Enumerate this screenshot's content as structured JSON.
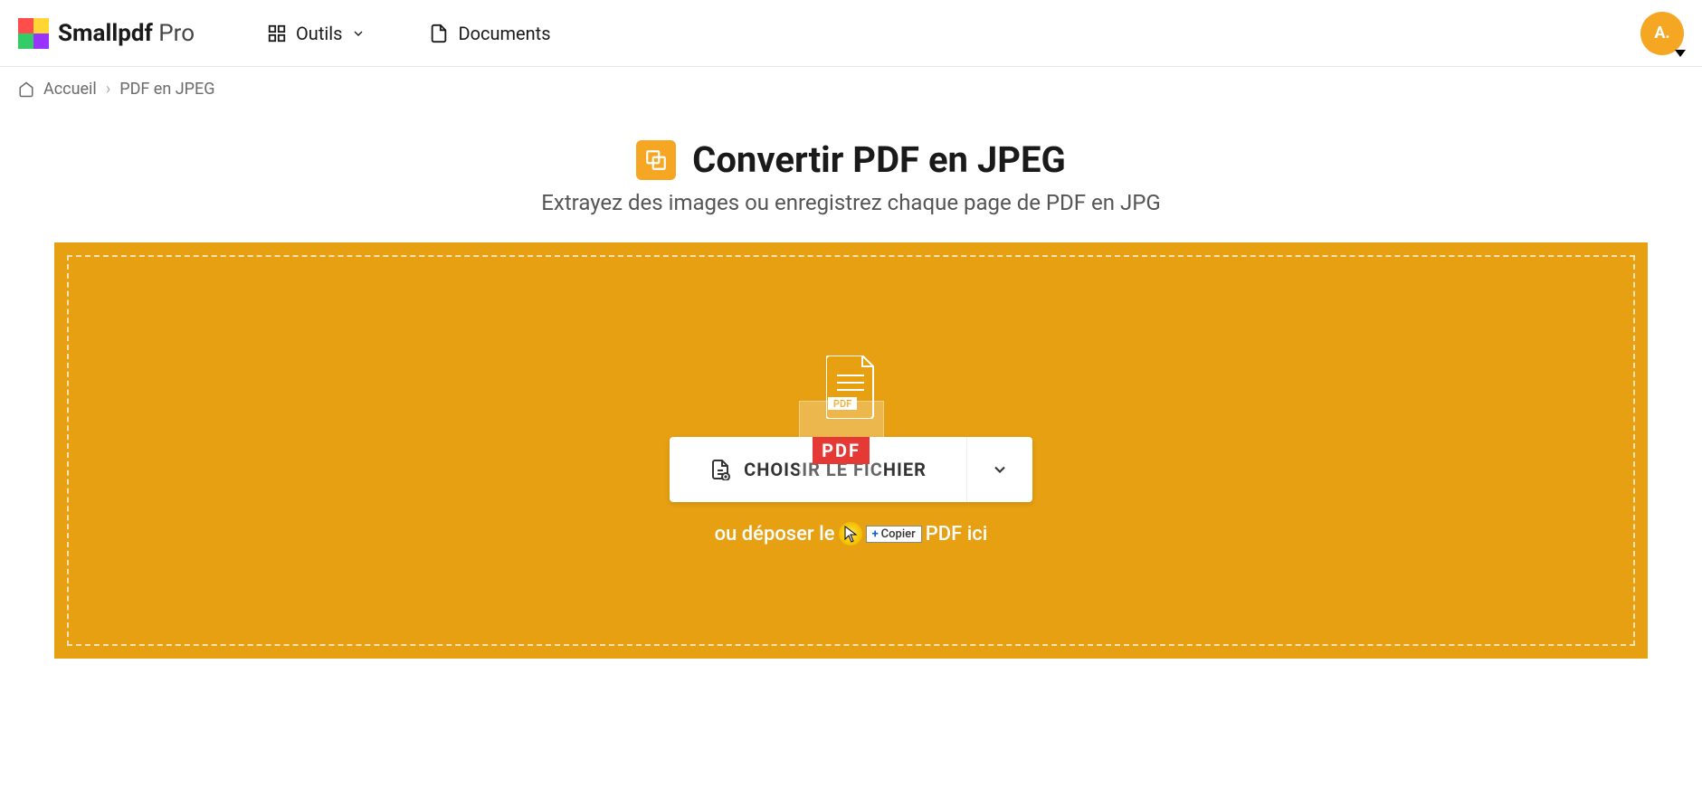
{
  "header": {
    "brand_main": "Smallpdf",
    "brand_suffix": "Pro",
    "tools_label": "Outils",
    "documents_label": "Documents",
    "avatar_initials": "A."
  },
  "breadcrumb": {
    "home_label": "Accueil",
    "separator": "›",
    "current_label": "PDF en JPEG"
  },
  "page": {
    "title": "Convertir PDF en JPEG",
    "subtitle": "Extrayez des images ou enregistrez chaque page de PDF en JPG"
  },
  "dropzone": {
    "pdf_badge": "PDF",
    "drag_badge": "PDF",
    "choose_label": "CHOISIR LE FICHIER",
    "hint_prefix": "ou déposer le ",
    "hint_suffix": "PDF ici",
    "copy_tooltip": "Copier"
  },
  "colors": {
    "accent": "#e6a012",
    "avatar": "#f5a623",
    "drag_badge_bg": "#e53935"
  }
}
